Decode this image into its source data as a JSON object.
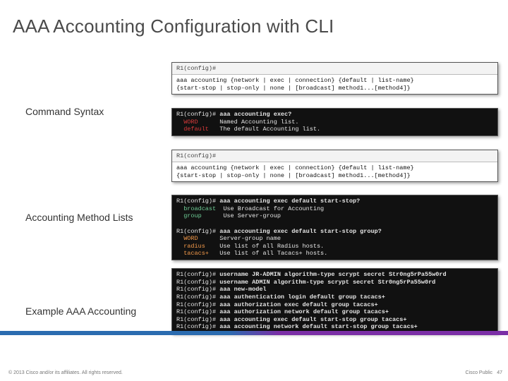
{
  "title": "AAA Accounting Configuration with CLI",
  "labels": {
    "syntax": "Command Syntax",
    "lists": "Accounting Method Lists",
    "example": "Example AAA Accounting"
  },
  "boxes": {
    "syntax1": {
      "hdr": "R1(config)#",
      "line1": "aaa accounting {network | exec | connection} {default | list-name}",
      "line2": "{start-stop | stop-only | none | [broadcast] method1...[method4]}"
    },
    "syntax_help": {
      "prompt": "R1(config)# ",
      "cmd": "aaa accounting exec?",
      "rows": [
        [
          "WORD",
          "Named Accounting list."
        ],
        [
          "default",
          "The default Accounting list."
        ]
      ]
    },
    "syntax2": {
      "hdr": "R1(config)#",
      "line1": "aaa accounting {network | exec | connection} {default | list-name}",
      "line2": "{start-stop | stop-only | none | [broadcast] method1...[method4]}"
    },
    "lists_help": {
      "prompt1": "R1(config)# ",
      "cmd1": "aaa accounting exec default start-stop?",
      "rows1": [
        [
          "broadcast",
          "Use Broadcast for Accounting"
        ],
        [
          "group",
          "Use Server-group"
        ]
      ],
      "prompt2": "R1(config)# ",
      "cmd2": "aaa accounting exec default start-stop group?",
      "rows2": [
        [
          "WORD",
          "Server-group name"
        ],
        [
          "radius",
          "Use list of all Radius hosts."
        ],
        [
          "tacacs+",
          "Use list of all Tacacs+ hosts."
        ]
      ]
    },
    "example": {
      "lines": [
        [
          "R1(config)# ",
          "username JR-ADMIN algorithm-type scrypt secret Str0ng5rPa55w0rd"
        ],
        [
          "R1(config)# ",
          "username ADMIN algorithm-type scrypt secret Str0ng5rPa55w0rd"
        ],
        [
          "R1(config)# ",
          "aaa new-model"
        ],
        [
          "R1(config)# ",
          "aaa authentication login default group tacacs+"
        ],
        [
          "R1(config)# ",
          "aaa authorization exec default group tacacs+"
        ],
        [
          "R1(config)# ",
          "aaa authorization network default group tacacs+"
        ],
        [
          "R1(config)# ",
          "aaa accounting exec default start-stop group tacacs+"
        ],
        [
          "R1(config)# ",
          "aaa accounting network default start-stop group tacacs+"
        ]
      ]
    }
  },
  "footer": {
    "copyright": "© 2013 Cisco and/or its affiliates. All rights reserved.",
    "right": "Cisco Public",
    "page": "47"
  }
}
